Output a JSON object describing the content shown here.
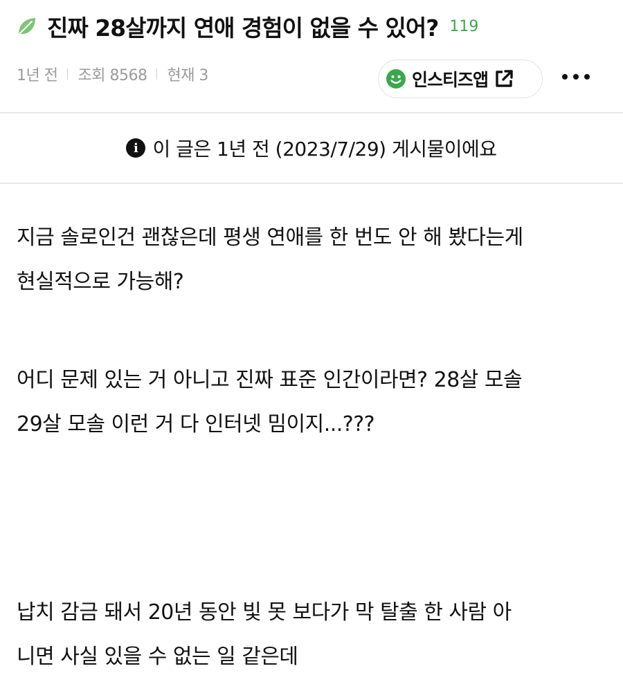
{
  "post": {
    "title": "진짜 28살까지 연애 경험이 없을 수 있어?",
    "comment_count": "119",
    "time_ago": "1년 전",
    "views": "조회 8568",
    "current": "현재 3",
    "app_button_label": "인스티즈앱",
    "notice": "이 글은 1년 전 (2023/7/29) 게시물이에요",
    "notice_icon": "info-icon",
    "board_icon": "leaf-icon",
    "paragraphs": [
      {
        "lines": [
          "지금 솔로인건 괜찮은데 평생 연애를 한 번도 안 해 봤다는게",
          "현실적으로 가능해?"
        ]
      },
      {
        "lines": [
          "어디 문제 있는 거 아니고 진짜 표준 인간이라면? 28살 모솔",
          "29살 모솔 이런 거 다 인터넷 밈이지...???"
        ]
      },
      {
        "lines": [
          "납치 감금 돼서 20년 동안 빛 못 보다가 막 탈출 한 사람 아",
          "니면 사실 있을 수 없는 일 같은데"
        ]
      }
    ]
  },
  "colors": {
    "accent_green": "#3aa84a",
    "meta_gray": "#9a9a9a",
    "divider": "#e8e8e8"
  }
}
